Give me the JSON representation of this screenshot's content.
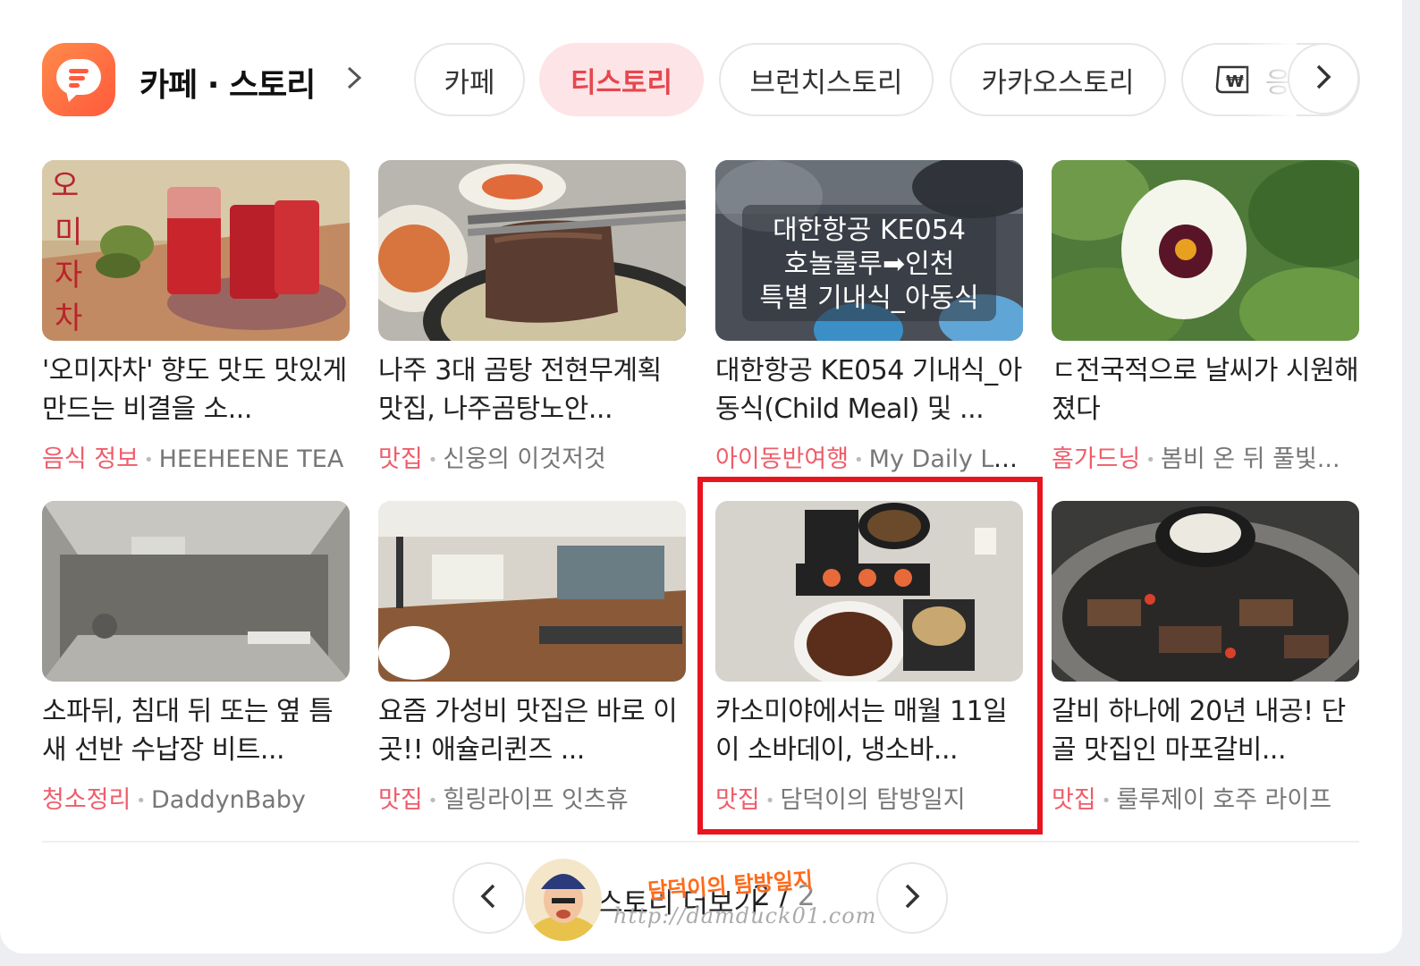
{
  "header": {
    "title": "카페 · 스토리",
    "tabs": [
      {
        "label": "카페",
        "active": false
      },
      {
        "label": "티스토리",
        "active": true
      },
      {
        "label": "브런치스토리",
        "active": false
      },
      {
        "label": "카카오스토리",
        "active": false
      },
      {
        "label": "응",
        "active": false,
        "icon": "banknote-icon"
      }
    ]
  },
  "items": [
    {
      "title": "'오미자차' 향도 맛도 맛있게 만드는 비결을 소...",
      "category": "음식 정보",
      "source": "HEEHEENE TEA",
      "image": "omija-tea-drawing"
    },
    {
      "title": "나주 3대 곰탕 전현무계획 맛집, 나주곰탕노안...",
      "category": "맛집",
      "source": "신웅의 이것저것",
      "image": "gomtang-meat"
    },
    {
      "title": "대한항공 KE054 기내식_아동식(Child Meal) 및 ...",
      "category": "아이동반여행",
      "source": "My Daily Log",
      "image": "in-flight-meal",
      "overlay": [
        "대한항공 KE054",
        "호놀룰루➡인천",
        "특별 기내식_아동식"
      ]
    },
    {
      "title": "ㄷ전국적으로 날씨가 시원해 졌다",
      "category": "홈가드닝",
      "source": "봄비 온 뒤 풀빛...",
      "image": "white-flower"
    },
    {
      "title": "소파뒤, 침대 뒤 또는 옆 틈새 선반 수납장 비트...",
      "category": "청소정리",
      "source": "DaddynBaby",
      "image": "shelf-gap"
    },
    {
      "title": "요즘 가성비 맛집은 바로 이곳!! 애슐리퀸즈 ...",
      "category": "맛집",
      "source": "힐링라이프 잇츠휴",
      "image": "buffet-restaurant"
    },
    {
      "title": "카소미야에서는 매월 11일이 소바데이, 냉소바...",
      "category": "맛집",
      "source": "담덕이의 탐방일지",
      "image": "soba-table",
      "highlighted": true
    },
    {
      "title": "갈비 하나에 20년 내공! 단골 맛집인 마포갈비...",
      "category": "맛집",
      "source": "룰루제이 호주 라이프",
      "image": "charcoal-grill"
    }
  ],
  "footer": {
    "more_label": "스토리 더보기",
    "page_current": "2",
    "page_total": "2",
    "watermark_name": "담덕이의 탐방일지",
    "watermark_url": "http://damduck01.com"
  },
  "colors": {
    "accent": "#e8464f",
    "category": "#ef5d6a",
    "highlight": "#e8141e",
    "logo": "#ff5a3c"
  }
}
